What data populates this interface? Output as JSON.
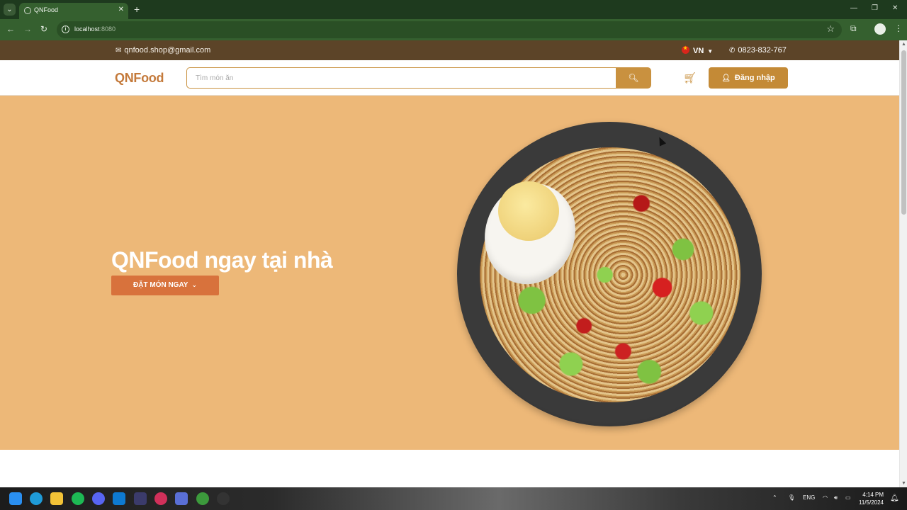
{
  "browser": {
    "tab_title": "QNFood",
    "url_host": "localhost",
    "url_port": ":8080",
    "new_tab_label": "+",
    "close_tab_label": "✕"
  },
  "topbar": {
    "email": "qnfood.shop@gmail.com",
    "language": "VN",
    "phone": "0823-832-767"
  },
  "header": {
    "logo": "QNFood",
    "search_placeholder": "Tìm món ăn",
    "login_label": "Đăng nhập"
  },
  "hero": {
    "title": "QNFood ngay tại nhà",
    "cta_label": "ĐẶT MÓN NGAY"
  },
  "taskbar": {
    "language": "ENG",
    "time": "4:14 PM",
    "date": "11/5/2024"
  },
  "colors": {
    "topbar_bg": "#5c4428",
    "accent": "#c9913f",
    "hero_bg": "#edb878",
    "cta_bg": "#d8723c",
    "logo": "#c47a3b"
  },
  "icons": [
    "tab-list-icon",
    "globe-favicon-icon",
    "back-arrow-icon",
    "forward-arrow-icon",
    "reload-icon",
    "site-info-icon",
    "bookmark-star-icon",
    "extensions-icon",
    "profile-icon",
    "menu-dots-icon",
    "mail-icon",
    "vietnam-flag-icon",
    "phone-icon",
    "search-icon",
    "cart-icon",
    "user-icon",
    "chevron-down-icon"
  ]
}
